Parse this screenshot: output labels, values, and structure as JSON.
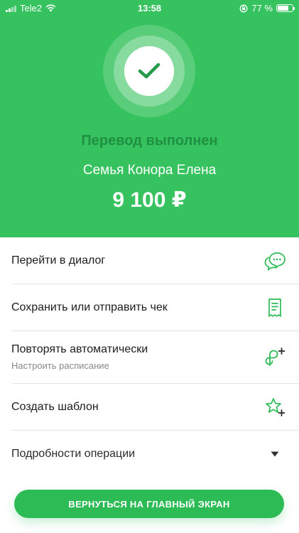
{
  "status_bar": {
    "carrier": "Tele2",
    "time": "13:58",
    "battery_percent": "77 %",
    "battery_level": 0.77
  },
  "hero": {
    "status": "Перевод выполнен",
    "recipient": "Семья Конора Елена",
    "amount": "9 100 ₽",
    "colors": {
      "background": "#36c25f",
      "status_text": "#1f8f42"
    }
  },
  "actions": [
    {
      "label": "Перейти в диалог",
      "icon": "chat-bubbles-icon"
    },
    {
      "label": "Сохранить или отправить чек",
      "icon": "receipt-icon"
    },
    {
      "label": "Повторять автоматически",
      "sublabel": "Настроить расписание",
      "icon": "repeat-add-icon"
    },
    {
      "label": "Создать шаблон",
      "icon": "star-add-icon"
    },
    {
      "label": "Подробности операции",
      "icon": "triangle-down-icon"
    }
  ],
  "primary_button": {
    "label": "ВЕРНУТЬСЯ НА ГЛАВНЫЙ ЭКРАН"
  },
  "accent_color": "#2dbb56"
}
